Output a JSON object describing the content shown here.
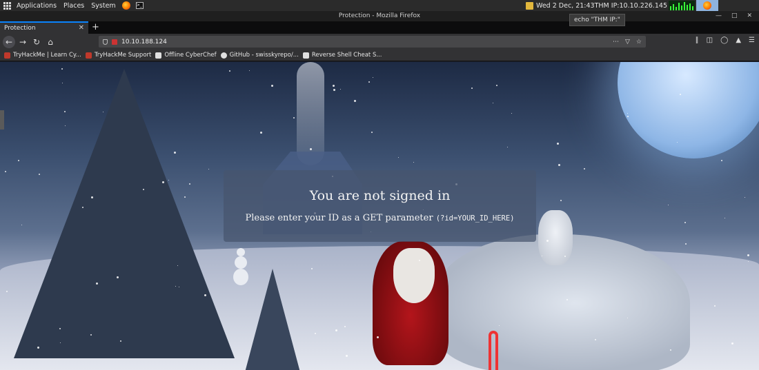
{
  "panel": {
    "applications": "Applications",
    "places": "Places",
    "system": "System",
    "clock": "Wed  2 Dec, 21:43",
    "thm_ip": "THM IP:10.10.226.145"
  },
  "tooltip": "echo \"THM IP:\"",
  "window": {
    "title": "Protection - Mozilla Firefox"
  },
  "tab": {
    "title": "Protection"
  },
  "url": "10.10.188.124",
  "bookmarks": [
    {
      "label": "TryHackMe | Learn Cy...",
      "color": "#c0392b"
    },
    {
      "label": "TryHackMe Support",
      "color": "#c0392b"
    },
    {
      "label": "Offline CyberChef",
      "color": "#e0e0e0"
    },
    {
      "label": "GitHub - swisskyrepo/...",
      "color": "#e0e0e0"
    },
    {
      "label": "Reverse Shell Cheat S...",
      "color": "#e0e0e0"
    }
  ],
  "page": {
    "heading": "You are not signed in",
    "message": "Please enter your ID as a GET parameter",
    "code": "(?id=YOUR_ID_HERE)"
  }
}
